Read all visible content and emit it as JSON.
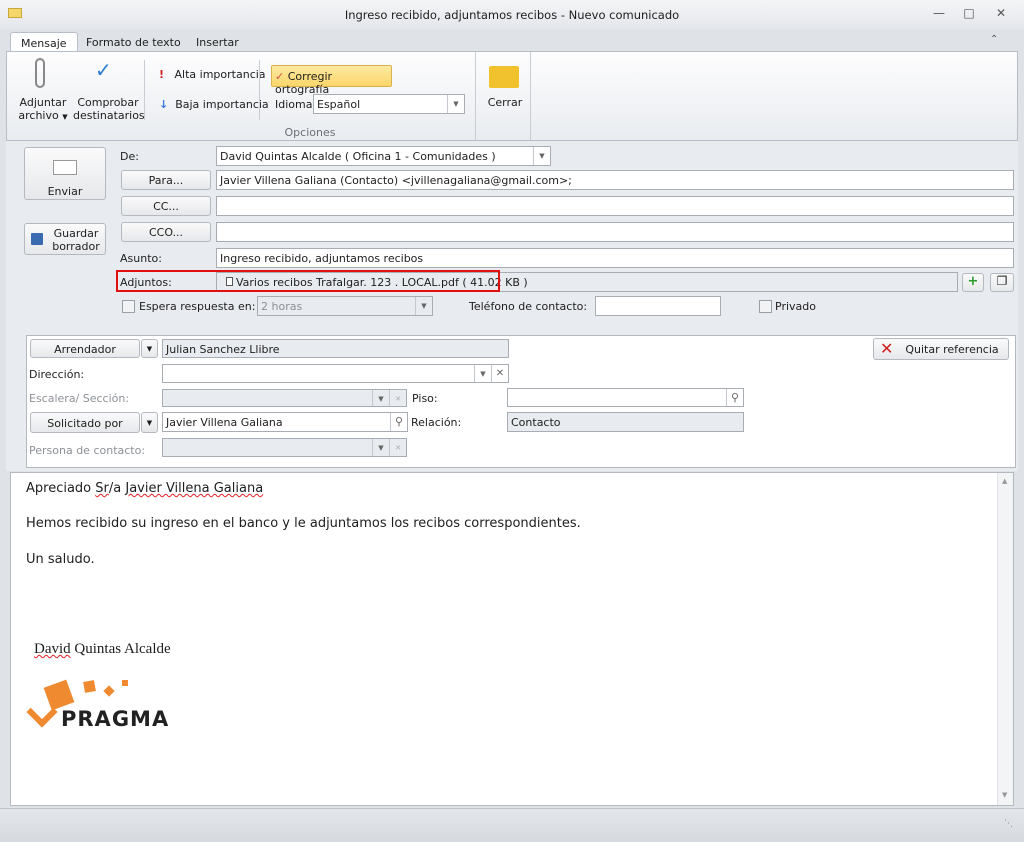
{
  "window": {
    "title": "Ingreso recibido, adjuntamos recibos - Nuevo comunicado"
  },
  "tabs": [
    "Mensaje",
    "Formato de texto",
    "Insertar"
  ],
  "ribbon": {
    "attach": "Adjuntar",
    "attach2": "archivo",
    "check": "Comprobar",
    "check2": "destinatarios",
    "high": "Alta importancia",
    "low": "Baja importancia",
    "spell": "Corregir ortografía",
    "lang_label": "Idioma:",
    "lang_value": "Español",
    "group_label": "Opciones",
    "close": "Cerrar"
  },
  "form": {
    "send": "Enviar",
    "save1": "Guardar",
    "save2": "borrador",
    "from_label": "De:",
    "from_value": "David Quintas Alcalde ( Oficina 1 - Comunidades )",
    "to_btn": "Para...",
    "to_value": "Javier Villena Galiana (Contacto) <jvillenagaliana@gmail.com>;",
    "cc_btn": "CC...",
    "cc_value": "",
    "bcc_btn": "CCO...",
    "bcc_value": "",
    "subject_label": "Asunto:",
    "subject_value": "Ingreso recibido, adjuntamos recibos",
    "attach_label": "Adjuntos:",
    "attachment": "Varios recibos Trafalgar. 123 . LOCAL.pdf ( 41.02 KB )",
    "wait_label": "Espera respuesta en:",
    "wait_value": "2 horas",
    "phone_label": "Teléfono de contacto:",
    "phone_value": "",
    "private_label": "Privado"
  },
  "reference": {
    "type_btn": "Arrendador",
    "type_value": "Julian Sanchez Llibre",
    "address_label": "Dirección:",
    "stair_label": "Escalera/ Sección:",
    "floor_label": "Piso:",
    "requested_btn": "Solicitado por",
    "requested_value": "Javier Villena Galiana",
    "relation_label": "Relación:",
    "relation_value": "Contacto",
    "contact_label": "Persona de contacto:",
    "remove_btn": "Quitar referencia"
  },
  "body": {
    "greeting_pre": "Apreciado ",
    "greeting_sr": "Sr",
    "greeting_mid": "/a ",
    "greeting_name": "Javier Villena Galiana",
    "line2": "Hemos recibido su ingreso en el banco y le adjuntamos los recibos correspondientes.",
    "line3": "Un saludo.",
    "sig_first": "David",
    "sig_rest": " Quintas Alcalde",
    "logo": "PRAGMA"
  }
}
